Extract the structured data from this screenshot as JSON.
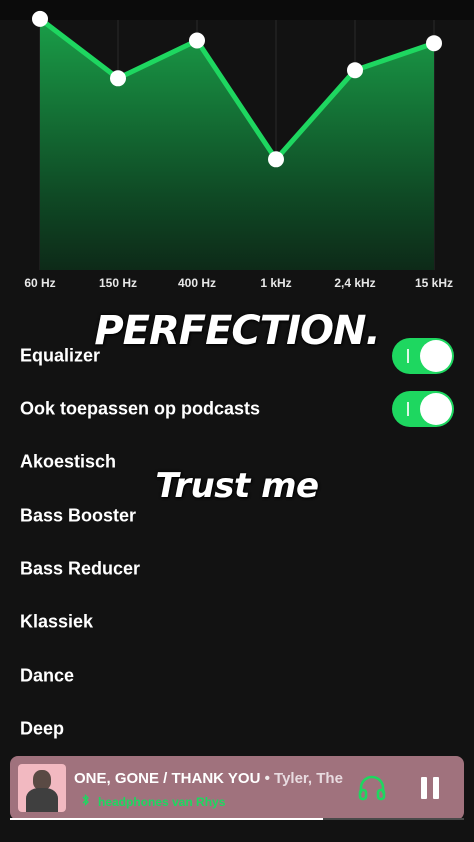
{
  "equalizer": {
    "bands": [
      {
        "label": "60 Hz",
        "gain": 0.93
      },
      {
        "label": "150 Hz",
        "gain": 0.71
      },
      {
        "label": "400 Hz",
        "gain": 0.85
      },
      {
        "label": "1 kHz",
        "gain": 0.41
      },
      {
        "label": "2,4 kHz",
        "gain": 0.74
      },
      {
        "label": "15 kHz",
        "gain": 0.84
      }
    ],
    "accent_color": "#1ed760"
  },
  "overlay": {
    "headline": "PERFECTION.",
    "subline": "Trust me"
  },
  "settings": {
    "equalizer_label": "Equalizer",
    "equalizer_on": true,
    "podcasts_label": "Ook toepassen op podcasts",
    "podcasts_on": true
  },
  "presets": [
    "Akoestisch",
    "Bass Booster",
    "Bass Reducer",
    "Klassiek",
    "Dance",
    "Deep"
  ],
  "player": {
    "track_title": "ONE, GONE / THANK YOU",
    "separator": " • ",
    "artist": "Tyler, The C",
    "device": "headphones van Rhys",
    "device_icon": "bluetooth-icon",
    "progress": 0.69,
    "background_color": "#a0727d"
  }
}
